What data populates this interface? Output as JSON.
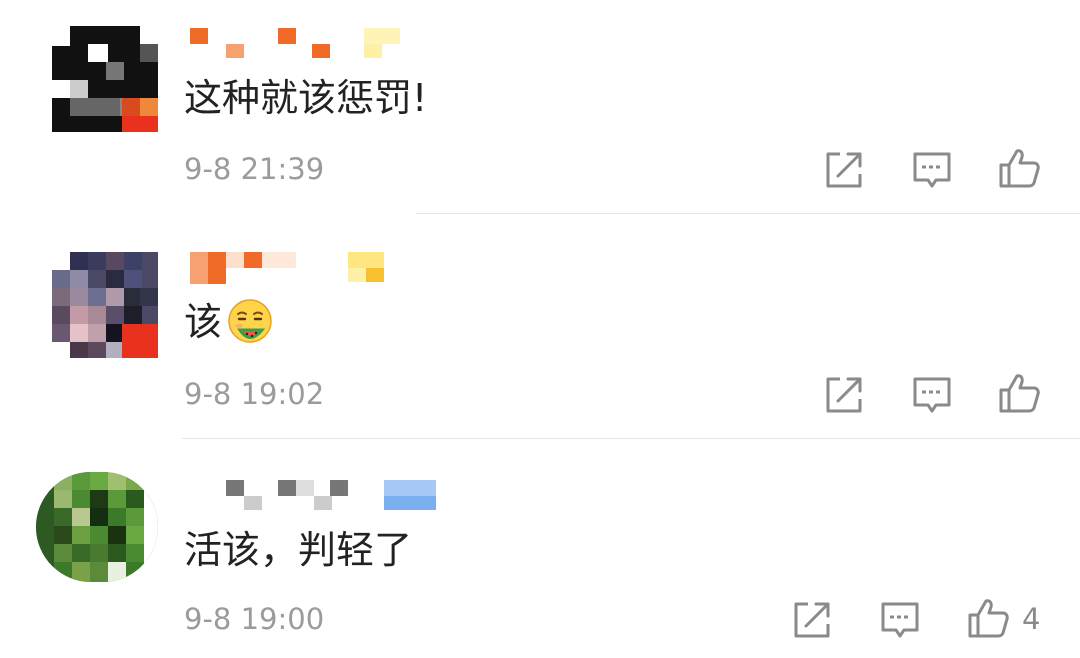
{
  "comments": [
    {
      "text": "这种就该惩罚!",
      "time": "9-8 21:39",
      "like_count": ""
    },
    {
      "text": "该",
      "emoji": "watermelon-eating-face-emoji",
      "time": "9-8 19:02",
      "like_count": ""
    },
    {
      "text": "活该，判轻了",
      "time": "9-8 19:00",
      "like_count": "4"
    }
  ],
  "icons": {
    "share": "share-icon",
    "reply": "comment-icon",
    "like": "thumbs-up-icon"
  },
  "colors": {
    "text": "#222222",
    "meta": "#9b9b9b",
    "icon": "#8a8a8a",
    "divider": "#e6e6e6"
  }
}
